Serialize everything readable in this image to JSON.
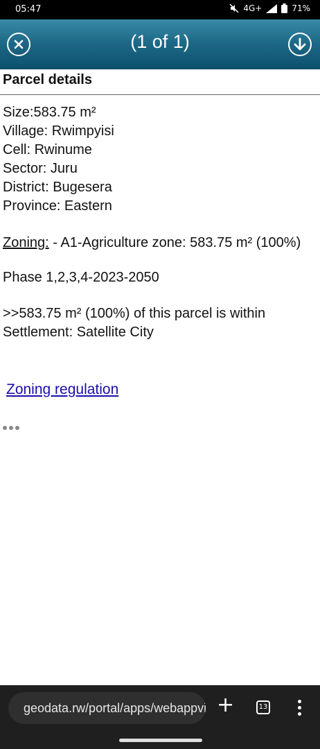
{
  "status_bar": {
    "time": "05:47",
    "network": "4G+",
    "battery": "71%",
    "icons": [
      "mute-icon",
      "signal-icon",
      "battery-icon"
    ]
  },
  "popup": {
    "title": "(1 of 1)",
    "close_icon": "close-circle-icon",
    "download_icon": "download-circle-icon",
    "header_color": "#1e6a88"
  },
  "parcel": {
    "section_title": "Parcel details",
    "details": [
      "Size:583.75 m²",
      "Village: Rwimpyisi",
      "Cell: Rwinume",
      "Sector: Juru",
      "District: Bugesera",
      "Province: Eastern"
    ],
    "zoning_label": "Zoning:",
    "zoning_value": " - A1-Agriculture zone: 583.75 m² (100%)",
    "phase": "Phase 1,2,3,4-2023-2050",
    "settlement_line1": ">>583.75 m² (100%) of this parcel is within",
    "settlement_line2": "Settlement: Satellite City",
    "regulation_link": "Zoning regulation"
  },
  "browser": {
    "url": "geodata.rw/portal/apps/webappviewer",
    "tab_count": "13",
    "icons": [
      "site-settings-icon",
      "plus-icon",
      "tabs-icon",
      "more-vert-icon"
    ]
  }
}
